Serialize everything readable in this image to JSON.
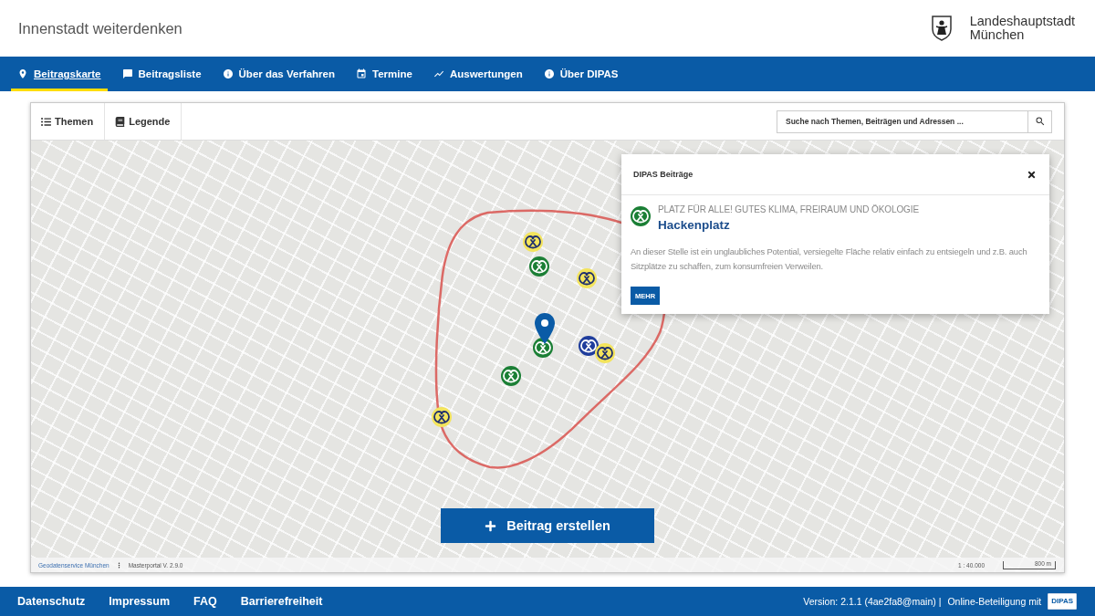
{
  "header": {
    "title": "Innenstadt weiterdenken",
    "logo_lines": [
      "Landeshauptstadt",
      "München"
    ]
  },
  "nav": [
    {
      "label": "Beitragskarte",
      "selected": true
    },
    {
      "label": "Beitragsliste",
      "selected": false
    },
    {
      "label": "Über das Verfahren",
      "selected": false
    },
    {
      "label": "Termine",
      "selected": false
    },
    {
      "label": "Auswertungen",
      "selected": false
    },
    {
      "label": "Über DIPAS",
      "selected": false
    }
  ],
  "map_toolbar": {
    "buttons": [
      "Themen",
      "Legende"
    ],
    "search": {
      "placeholder": "Suche nach Themen, Beiträgen und Adressen ..."
    }
  },
  "map": {
    "markers": [
      {
        "color": "#f3e45c",
        "selected": false
      },
      {
        "color": "#1b7f35",
        "selected": false
      },
      {
        "color": "#f3e45c",
        "selected": false
      },
      {
        "color": "#1b7f35",
        "selected": true
      },
      {
        "color": "#1f3d9c",
        "selected": false
      },
      {
        "color": "#f3e45c",
        "selected": false
      },
      {
        "color": "#1b7f35",
        "selected": false
      },
      {
        "color": "#f3e45c",
        "selected": false
      }
    ],
    "popup": {
      "title": "DIPAS Beiträge",
      "entry": {
        "color": "#1b7f35",
        "category": "PLATZ FÜR ALLE! GUTES KLIMA, FREIRAUM UND ÖKOLOGIE",
        "title": "Hackenplatz",
        "text": "An dieser Stelle ist ein unglaubliches Potential, versiegelte Fläche relativ einfach zu entsiegeln und z.B. auch Sitzplätze zu schaffen, zum konsumfreien Verweilen.",
        "button": "MEHR"
      }
    },
    "create_button": "Beitrag erstellen",
    "attribution": {
      "provider": "Geodatenservice München",
      "version": "Masterportal V. 2.9.0",
      "scale": "1 : 40.000",
      "scale_bar": "800 m"
    }
  },
  "footer": {
    "links": [
      "Datenschutz",
      "Impressum",
      "FAQ",
      "Barrierefreiheit"
    ],
    "version": "Version: 2.1.1 (4ae2fa8@main) |",
    "credit": "Online-Beteiligung mit",
    "logo": "DIPAS"
  }
}
